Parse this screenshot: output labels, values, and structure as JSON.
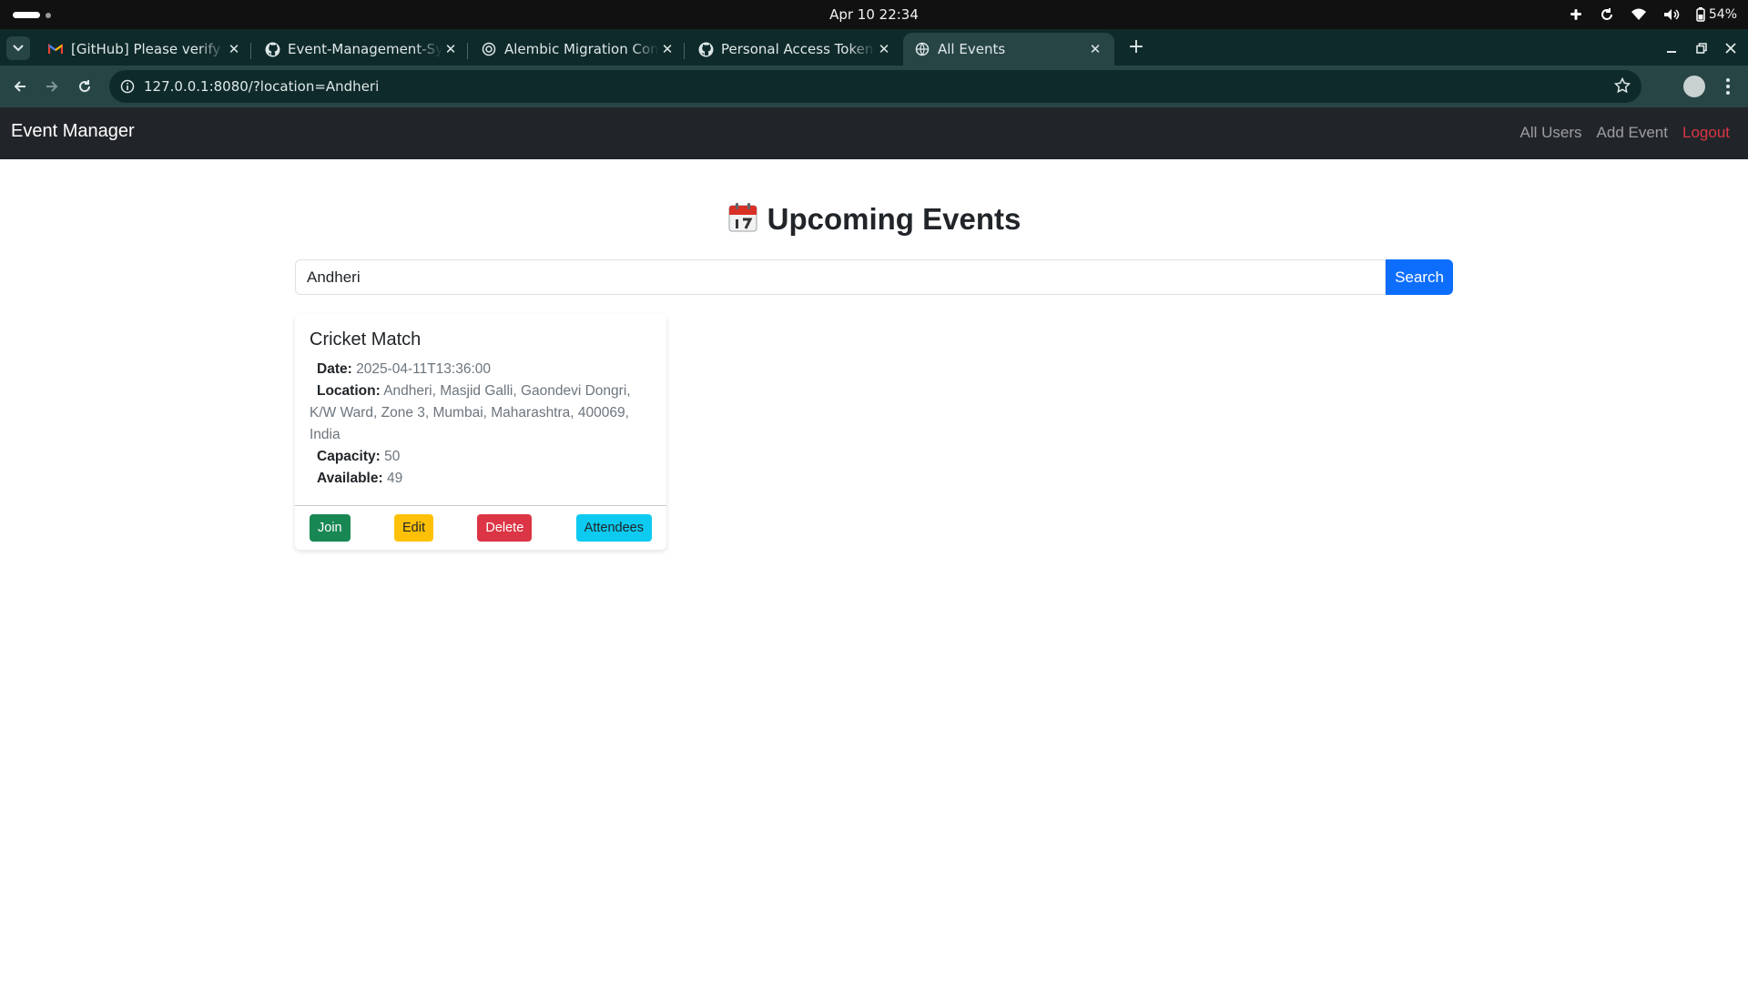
{
  "os": {
    "clock": "Apr 10  22:34",
    "battery": "54%"
  },
  "browser": {
    "tabs": [
      {
        "title": "[GitHub] Please verify yo",
        "icon": "gmail-icon"
      },
      {
        "title": "Event-Management-Syst",
        "icon": "github-icon"
      },
      {
        "title": "Alembic Migration Comm",
        "icon": "globe-icon"
      },
      {
        "title": "Personal Access Tokens (",
        "icon": "github-icon"
      },
      {
        "title": "All Events",
        "icon": "globe-icon"
      }
    ],
    "url": "127.0.0.1:8080/?location=Andheri"
  },
  "navbar": {
    "brand": "Event Manager",
    "links": [
      "All Users",
      "Add Event",
      "Logout"
    ]
  },
  "main": {
    "title": "Upcoming Events",
    "search": {
      "value": "Andheri",
      "button": "Search"
    },
    "events": [
      {
        "name": "Cricket Match",
        "date_label": "Date:",
        "date": "2025-04-11T13:36:00",
        "location_label": "Location:",
        "location": "Andheri, Masjid Galli, Gaondevi Dongri, K/W Ward, Zone 3, Mumbai, Maharashtra, 400069, India",
        "capacity_label": "Capacity:",
        "capacity": "50",
        "available_label": "Available:",
        "available": "49",
        "actions": [
          "Join",
          "Edit",
          "Delete",
          "Attendees"
        ]
      }
    ]
  },
  "colors": {
    "navbar_bg": "#212529",
    "primary": "#0d6efd",
    "success": "#198754",
    "warning": "#ffc107",
    "danger": "#dc3545",
    "info": "#0dcaf0"
  }
}
